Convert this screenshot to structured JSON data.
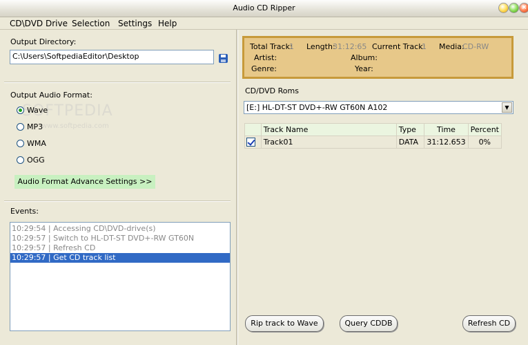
{
  "window": {
    "title": "Audio CD Ripper"
  },
  "menu": [
    "CD\\DVD Drive",
    "Selection",
    "Settings",
    "Help"
  ],
  "output": {
    "dir_label": "Output Directory:",
    "dir_value": "C:\\Users\\SoftpediaEditor\\Desktop",
    "format_label": "Output Audio Format:",
    "formats": [
      {
        "label": "Wave",
        "selected": true
      },
      {
        "label": "MP3",
        "selected": false
      },
      {
        "label": "WMA",
        "selected": false
      },
      {
        "label": "OGG",
        "selected": false
      }
    ],
    "advance_button": "Audio Format Advance Settings >>"
  },
  "watermark": {
    "main": "SOFTPEDIA",
    "sub": "www.softpedia.com"
  },
  "events": {
    "label": "Events:",
    "items": [
      "10:29:54 | Accessing CD\\DVD-drive(s)",
      "10:29:57 | Switch to HL-DT-ST DVD+-RW GT60N",
      "10:29:57 | Refresh CD",
      "10:29:57 | Get CD track list"
    ],
    "selected_index": 3
  },
  "info": {
    "total_track_label": "Total Track:",
    "total_track_value": "1",
    "length_label": "Length:",
    "length_value": "31:12:65",
    "current_track_label": "Current Track:",
    "current_track_value": "1",
    "media_label": "Media:",
    "media_value": "CD-RW",
    "artist_label": "Artist:",
    "album_label": "Album:",
    "genre_label": "Genre:",
    "year_label": "Year:"
  },
  "roms": {
    "label": "CD/DVD Roms",
    "selected": "[E:]  HL-DT-ST  DVD+-RW GT60N     A102"
  },
  "tracks": {
    "headers": [
      "Track Name",
      "Type",
      "Time",
      "Percent"
    ],
    "rows": [
      {
        "checked": true,
        "name": "Track01",
        "type": "DATA",
        "time": "31:12.653",
        "percent": "0%"
      }
    ]
  },
  "buttons": {
    "rip": "Rip track to Wave",
    "query": "Query CDDB",
    "refresh": "Refresh CD"
  },
  "colors": {
    "info_bg": "#e7c889",
    "info_border": "#c79a3a",
    "advance_btn": "#c8f0c0",
    "selection": "#316ac5"
  }
}
